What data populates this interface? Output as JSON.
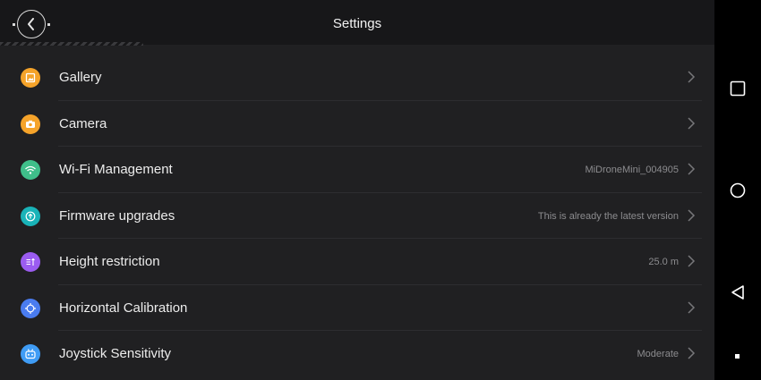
{
  "header": {
    "title": "Settings"
  },
  "colors": {
    "gallery": "#f5a32a",
    "camera": "#f5a32a",
    "wifi": "#3fbf8a",
    "firmware": "#19b3b8",
    "height": "#9b5cf0",
    "calibration": "#4a7cf0",
    "joystick": "#3f9cf5"
  },
  "settings": {
    "items": [
      {
        "label": "Gallery",
        "value": "",
        "icon": "gallery-icon"
      },
      {
        "label": "Camera",
        "value": "",
        "icon": "camera-icon"
      },
      {
        "label": "Wi-Fi Management",
        "value": "MiDroneMini_004905",
        "icon": "wifi-icon"
      },
      {
        "label": "Firmware upgrades",
        "value": "This is already the latest version",
        "icon": "upgrade-icon"
      },
      {
        "label": "Height restriction",
        "value": "25.0 m",
        "icon": "height-icon"
      },
      {
        "label": "Horizontal Calibration",
        "value": "",
        "icon": "calibration-icon"
      },
      {
        "label": "Joystick Sensitivity",
        "value": "Moderate",
        "icon": "joystick-icon"
      }
    ]
  },
  "navbar": {
    "icons": [
      "recents-icon",
      "home-icon",
      "back-icon",
      "indicator-dot"
    ]
  }
}
